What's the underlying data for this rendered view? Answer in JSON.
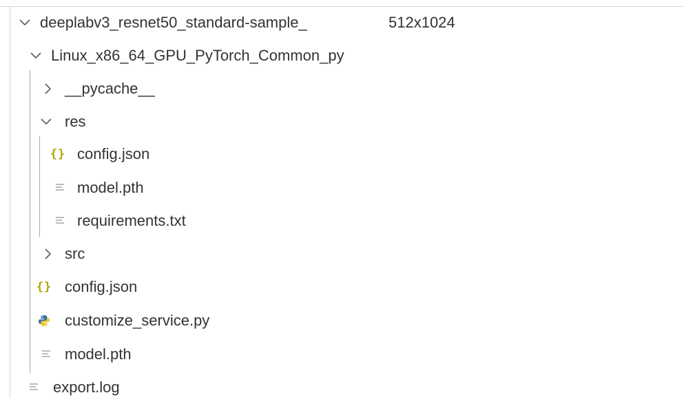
{
  "explorer": {
    "root": {
      "label": "deeplabv3_resnet50_standard-sample_",
      "suffix": "512x1024",
      "icon": "chevron-down-icon"
    },
    "items": [
      {
        "label": "Linux_x86_64_GPU_PyTorch_Common_py",
        "icon": "chevron-down-icon",
        "type": "folder",
        "expanded": true
      },
      {
        "label": "__pycache__",
        "icon": "chevron-right-icon",
        "type": "folder",
        "expanded": false
      },
      {
        "label": "res",
        "icon": "chevron-down-icon",
        "type": "folder",
        "expanded": true
      },
      {
        "label": "config.json",
        "icon": "json-file-icon",
        "type": "file"
      },
      {
        "label": "model.pth",
        "icon": "text-file-icon",
        "type": "file"
      },
      {
        "label": "requirements.txt",
        "icon": "text-file-icon",
        "type": "file"
      },
      {
        "label": "src",
        "icon": "chevron-right-icon",
        "type": "folder",
        "expanded": false
      },
      {
        "label": "config.json",
        "icon": "json-file-icon",
        "type": "file"
      },
      {
        "label": "customize_service.py",
        "icon": "python-file-icon",
        "type": "file"
      },
      {
        "label": "model.pth",
        "icon": "text-file-icon",
        "type": "file"
      },
      {
        "label": "export.log",
        "icon": "text-file-icon",
        "type": "file"
      }
    ],
    "colors": {
      "text": "#333333",
      "json_icon": "#b5a300",
      "python_blue": "#3572a5",
      "python_yellow": "#f2c230",
      "chevron": "#5a5a5a",
      "file_lines": "#a0a0a0"
    }
  }
}
